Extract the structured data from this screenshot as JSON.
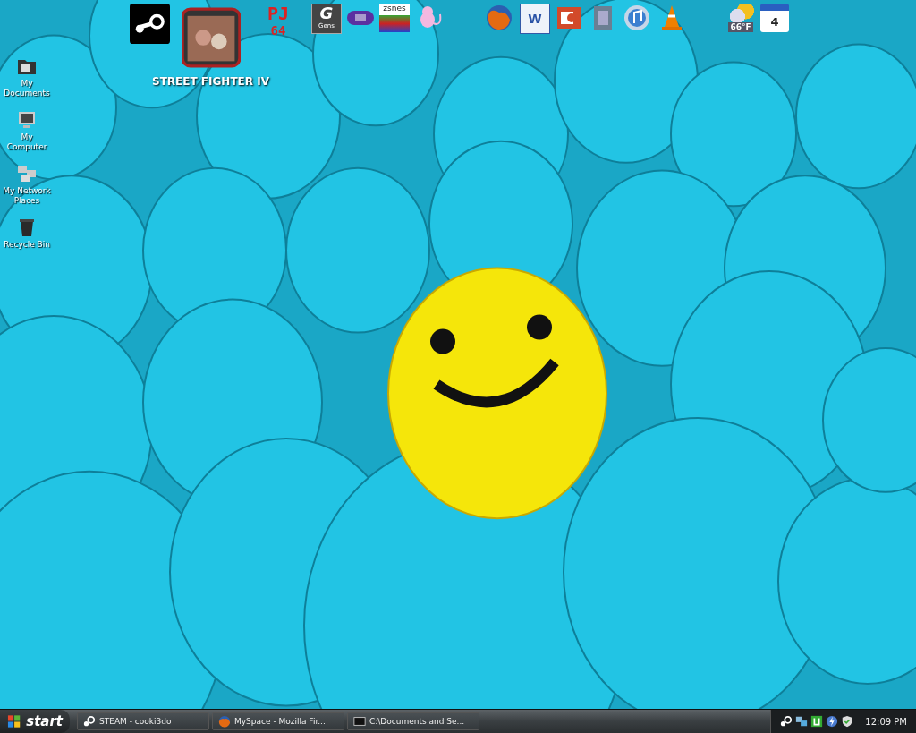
{
  "desktop_icons": [
    {
      "kind": "documents",
      "label": "My Documents"
    },
    {
      "kind": "computer",
      "label": "My Computer"
    },
    {
      "kind": "network",
      "label": "My Network Places"
    },
    {
      "kind": "recycle",
      "label": "Recycle Bin"
    }
  ],
  "dock": [
    {
      "kind": "steam"
    },
    {
      "kind": "fighter",
      "label": "STREET FIGHTER IV"
    },
    {
      "kind": "pj64",
      "texts": [
        "PJ",
        "64"
      ]
    },
    {
      "kind": "gens",
      "texts": [
        "G",
        "Gens"
      ]
    },
    {
      "kind": "gba"
    },
    {
      "kind": "zsnes",
      "texts": [
        "zsnes"
      ]
    },
    {
      "kind": "mew"
    },
    {
      "kind": "firefox"
    },
    {
      "kind": "word",
      "texts": [
        "W"
      ]
    },
    {
      "kind": "powerpoint"
    },
    {
      "kind": "media"
    },
    {
      "kind": "itunes"
    },
    {
      "kind": "vlc"
    },
    {
      "kind": "weather",
      "texts": [
        "66°F"
      ]
    },
    {
      "kind": "calendar",
      "texts": [
        "4"
      ]
    }
  ],
  "taskbar": {
    "start": "start",
    "tasks": [
      {
        "kind": "steam",
        "label": "STEAM - cooki3do",
        "selected": false
      },
      {
        "kind": "firefox",
        "label": "MySpace - Mozilla Fir...",
        "selected": false
      },
      {
        "kind": "console",
        "label": "C:\\Documents and Se...",
        "selected": false
      }
    ],
    "tray": [
      {
        "kind": "steam"
      },
      {
        "kind": "network"
      },
      {
        "kind": "torrent"
      },
      {
        "kind": "bolt"
      },
      {
        "kind": "shield"
      }
    ],
    "clock": "12:09 PM"
  }
}
